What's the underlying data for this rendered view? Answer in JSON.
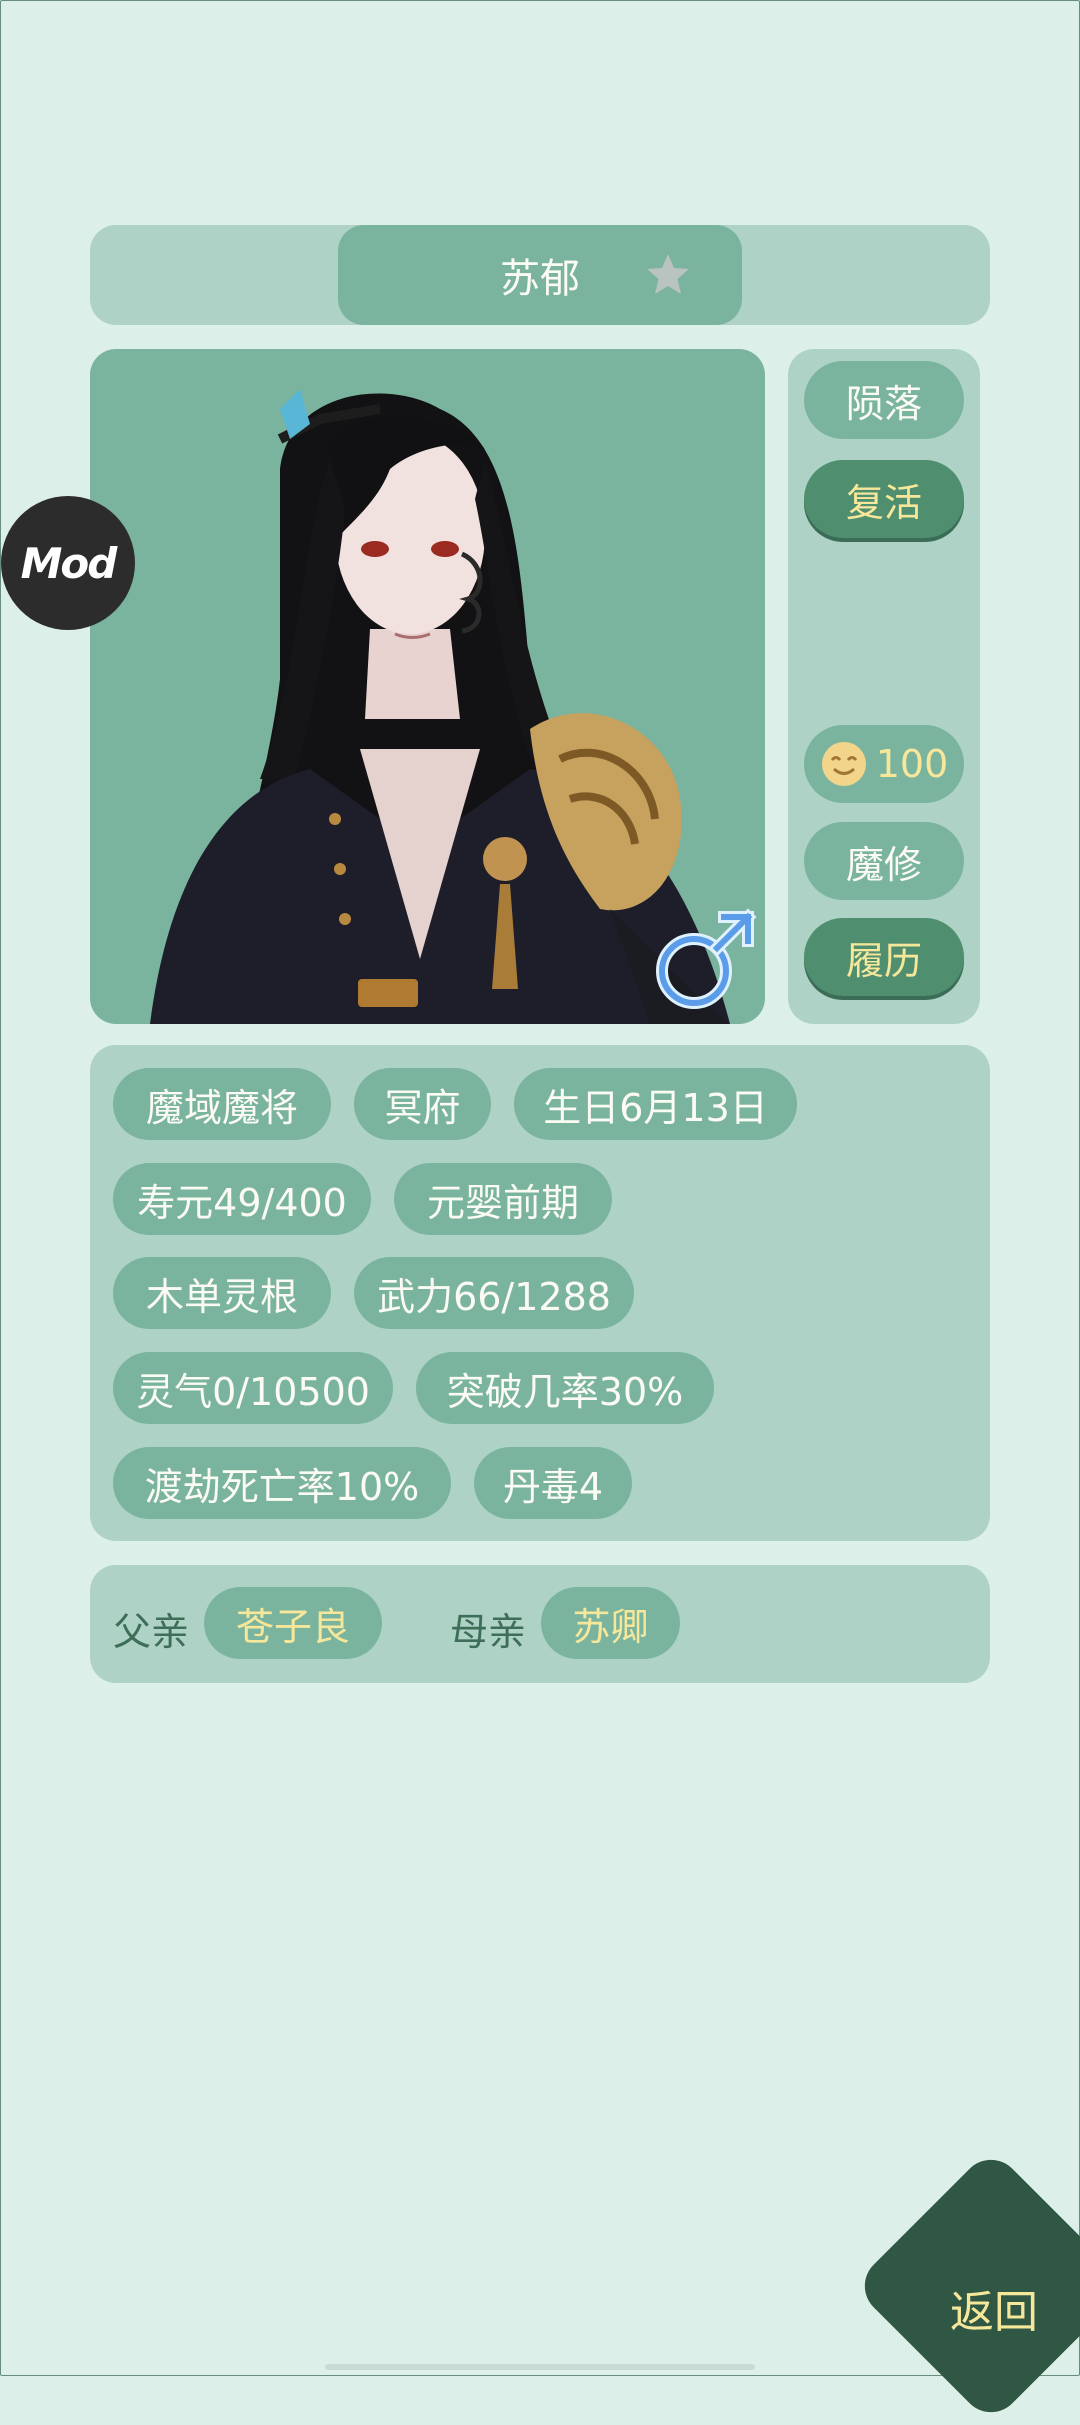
{
  "character": {
    "name": "苏郁",
    "gender_symbol": "♂"
  },
  "side_buttons": {
    "fallen": "陨落",
    "revive": "复活",
    "mood_value": "100",
    "cultivation_type": "魔修",
    "history": "履历"
  },
  "info_tags": [
    "魔域魔将",
    "冥府",
    "生日6月13日",
    "寿元49/400",
    "元婴前期",
    "木单灵根",
    "武力66/1288",
    "灵气0/10500",
    "突破几率30%",
    "渡劫死亡率10%",
    "丹毒4"
  ],
  "parents": {
    "father_label": "父亲",
    "father_name": "苍子良",
    "mother_label": "母亲",
    "mother_name": "苏卿"
  },
  "mod_badge": "Mod",
  "return_button": "返回",
  "colors": {
    "background": "#dcefe8",
    "panel": "#aed3c6",
    "chip": "#7ab49e",
    "dark_button": "#4f8f70",
    "accent_text": "#f6e79a",
    "return_bg": "#2f5744"
  }
}
